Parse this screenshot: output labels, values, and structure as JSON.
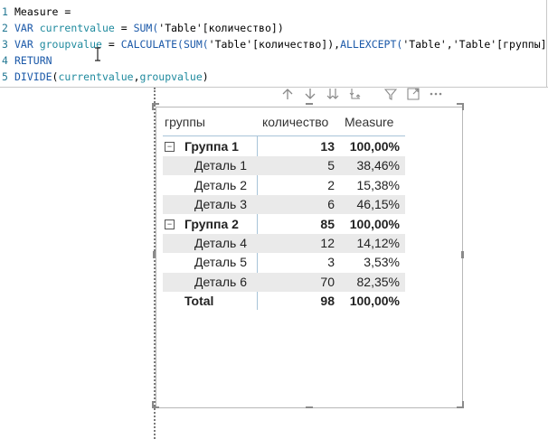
{
  "editor": {
    "lines": [
      {
        "num": "1",
        "tokens": [
          {
            "t": "Measure =",
            "c": "plain"
          }
        ]
      },
      {
        "num": "2",
        "tokens": [
          {
            "t": "VAR ",
            "c": "kw"
          },
          {
            "t": "currentvalue",
            "c": "var"
          },
          {
            "t": " = ",
            "c": "plain"
          },
          {
            "t": "SUM(",
            "c": "fn"
          },
          {
            "t": "'Table'",
            "c": "plain"
          },
          {
            "t": "[количество])",
            "c": "plain"
          }
        ]
      },
      {
        "num": "3",
        "tokens": [
          {
            "t": "VAR ",
            "c": "kw"
          },
          {
            "t": "groupvalue",
            "c": "var"
          },
          {
            "t": " = ",
            "c": "plain"
          },
          {
            "t": "CALCULATE(SUM(",
            "c": "fn"
          },
          {
            "t": "'Table'[количество]),",
            "c": "plain"
          },
          {
            "t": "ALLEXCEPT(",
            "c": "fn"
          },
          {
            "t": "'Table','Table'[группы]))",
            "c": "plain"
          }
        ]
      },
      {
        "num": "4",
        "tokens": [
          {
            "t": "RETURN",
            "c": "kw"
          }
        ]
      },
      {
        "num": "5",
        "tokens": [
          {
            "t": "DIVIDE",
            "c": "fn"
          },
          {
            "t": "(",
            "c": "plain"
          },
          {
            "t": "currentvalue",
            "c": "var"
          },
          {
            "t": ",",
            "c": "plain"
          },
          {
            "t": "groupvalue",
            "c": "var"
          },
          {
            "t": ")",
            "c": "plain"
          }
        ]
      }
    ]
  },
  "toolbar": {
    "icons": [
      "arrow-up-icon",
      "arrow-down-icon",
      "double-arrow-down-icon",
      "expand-hierarchy-icon",
      "filter-icon",
      "focus-mode-icon",
      "more-options-icon"
    ]
  },
  "matrix": {
    "headers": {
      "group": "группы",
      "qty": "количество",
      "measure": "Measure"
    },
    "expander_symbol": "⊟",
    "rows": [
      {
        "label": "Группа 1",
        "qty": "13",
        "measure": "100,00%",
        "type": "group",
        "shade": false
      },
      {
        "label": "Деталь 1",
        "qty": "5",
        "measure": "38,46%",
        "type": "detail",
        "shade": true
      },
      {
        "label": "Деталь 2",
        "qty": "2",
        "measure": "15,38%",
        "type": "detail",
        "shade": false
      },
      {
        "label": "Деталь 3",
        "qty": "6",
        "measure": "46,15%",
        "type": "detail",
        "shade": true
      },
      {
        "label": "Группа 2",
        "qty": "85",
        "measure": "100,00%",
        "type": "group",
        "shade": false
      },
      {
        "label": "Деталь 4",
        "qty": "12",
        "measure": "14,12%",
        "type": "detail",
        "shade": true
      },
      {
        "label": "Деталь 5",
        "qty": "3",
        "measure": "3,53%",
        "type": "detail",
        "shade": false
      },
      {
        "label": "Деталь 6",
        "qty": "70",
        "measure": "82,35%",
        "type": "detail",
        "shade": true
      },
      {
        "label": "Total",
        "qty": "98",
        "measure": "100,00%",
        "type": "total",
        "shade": false
      }
    ]
  }
}
